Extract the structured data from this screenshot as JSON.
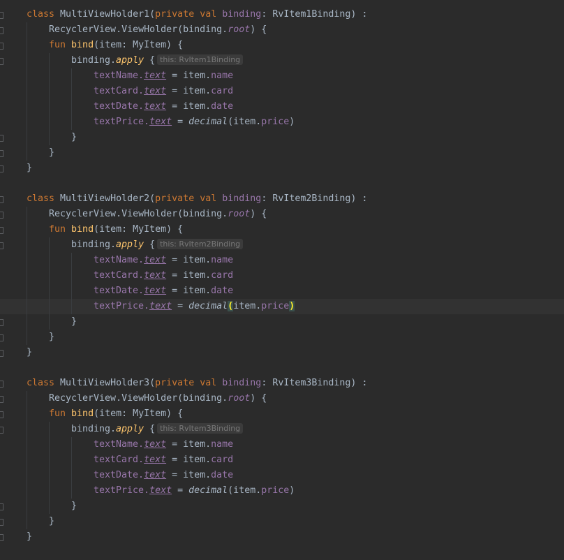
{
  "colors": {
    "background": "#2b2b2b",
    "keyword": "#cc7832",
    "function": "#ffc66d",
    "property": "#9876aa",
    "text": "#a9b7c6",
    "hint": "#787878"
  },
  "blocks": [
    {
      "class_kw": "class",
      "class_name": "MultiViewHolder1",
      "open_paren": "(",
      "private_kw": "private",
      "val_kw": "val",
      "binding_param": "binding",
      "colon1": ":",
      "binding_type": "RvItem1Binding",
      "close_sig": ") :",
      "super_call": "RecyclerView.ViewHolder(binding.",
      "root": "root",
      "super_end": ") {",
      "fun_kw": "fun",
      "fun_name": "bind",
      "fun_params": "(item: MyItem) {",
      "apply_recv": "binding.",
      "apply": "apply",
      "apply_brace": "{",
      "hint": "this: RvItem1Binding",
      "assignments": [
        {
          "receiver": "textName.",
          "prop": "text",
          "eq": " = item.",
          "value": "name"
        },
        {
          "receiver": "textCard.",
          "prop": "text",
          "eq": " = item.",
          "value": "card"
        },
        {
          "receiver": "textDate.",
          "prop": "text",
          "eq": " = item.",
          "value": "date"
        },
        {
          "receiver": "textPrice.",
          "prop": "text",
          "eq": " = ",
          "func": "decimal",
          "arg_open": "(item.",
          "value": "price",
          "arg_close": ")"
        }
      ],
      "close_apply": "}",
      "close_fun": "}",
      "close_class": "}"
    },
    {
      "class_kw": "class",
      "class_name": "MultiViewHolder2",
      "open_paren": "(",
      "private_kw": "private",
      "val_kw": "val",
      "binding_param": "binding",
      "colon1": ":",
      "binding_type": "RvItem2Binding",
      "close_sig": ") :",
      "super_call": "RecyclerView.ViewHolder(binding.",
      "root": "root",
      "super_end": ") {",
      "fun_kw": "fun",
      "fun_name": "bind",
      "fun_params": "(item: MyItem) {",
      "apply_recv": "binding.",
      "apply": "apply",
      "apply_brace": "{",
      "hint": "this: RvItem2Binding",
      "assignments": [
        {
          "receiver": "textName.",
          "prop": "text",
          "eq": " = item.",
          "value": "name"
        },
        {
          "receiver": "textCard.",
          "prop": "text",
          "eq": " = item.",
          "value": "card"
        },
        {
          "receiver": "textDate.",
          "prop": "text",
          "eq": " = item.",
          "value": "date"
        },
        {
          "receiver": "textPrice.",
          "prop": "text",
          "eq": " = ",
          "func": "decimal",
          "arg_open": "(",
          "arg_item": "item.",
          "value": "price",
          "arg_close": ")"
        }
      ],
      "close_apply": "}",
      "close_fun": "}",
      "close_class": "}"
    },
    {
      "class_kw": "class",
      "class_name": "MultiViewHolder3",
      "open_paren": "(",
      "private_kw": "private",
      "val_kw": "val",
      "binding_param": "binding",
      "colon1": ":",
      "binding_type": "RvItem3Binding",
      "close_sig": ") :",
      "super_call": "RecyclerView.ViewHolder(binding.",
      "root": "root",
      "super_end": ") {",
      "fun_kw": "fun",
      "fun_name": "bind",
      "fun_params": "(item: MyItem) {",
      "apply_recv": "binding.",
      "apply": "apply",
      "apply_brace": "{",
      "hint": "this: RvItem3Binding",
      "assignments": [
        {
          "receiver": "textName.",
          "prop": "text",
          "eq": " = item.",
          "value": "name"
        },
        {
          "receiver": "textCard.",
          "prop": "text",
          "eq": " = item.",
          "value": "card"
        },
        {
          "receiver": "textDate.",
          "prop": "text",
          "eq": " = item.",
          "value": "date"
        },
        {
          "receiver": "textPrice.",
          "prop": "text",
          "eq": " = ",
          "func": "decimal",
          "arg_open": "(item.",
          "value": "price",
          "arg_close": ")"
        }
      ],
      "close_apply": "}",
      "close_fun": "}",
      "close_class": "}"
    }
  ]
}
